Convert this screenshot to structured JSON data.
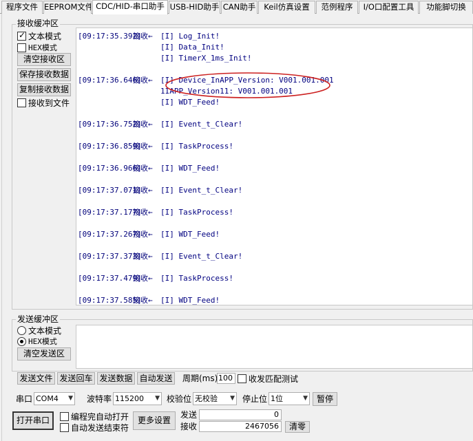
{
  "tabs": [
    {
      "label": "程序文件",
      "active": false
    },
    {
      "label": "EEPROM文件",
      "active": false
    },
    {
      "label": "CDC/HID-串口助手",
      "active": true
    },
    {
      "label": "USB-HID助手",
      "active": false
    },
    {
      "label": "CAN助手",
      "active": false
    },
    {
      "label": "Keil仿真设置",
      "active": false
    },
    {
      "label": "范例程序",
      "active": false
    },
    {
      "label": "I/O口配置工具",
      "active": false
    },
    {
      "label": "功能脚切换",
      "active": false
    }
  ],
  "receive": {
    "title": "接收缓冲区",
    "text_mode_label": "文本模式",
    "text_mode_checked": true,
    "hex_mode_label": "HEX模式",
    "hex_mode_checked": false,
    "clear_label": "清空接收区",
    "save_label": "保存接收数据",
    "copy_label": "复制接收数据",
    "to_file_label": "接收到文件",
    "to_file_checked": false,
    "log": [
      {
        "ts": "[09:17:35.392]",
        "tag": "接收←",
        "msg": "[I] Log_Init!"
      },
      {
        "ts": "",
        "tag": "",
        "msg": "[I] Data_Init!"
      },
      {
        "ts": "",
        "tag": "",
        "msg": "[I] TimerX_1ms_Init!"
      },
      {
        "ts": "",
        "tag": "",
        "msg": ""
      },
      {
        "ts": "[09:17:36.646]",
        "tag": "接收←",
        "msg": "[I] Device_InAPP_Version: V001.001.001"
      },
      {
        "ts": "",
        "tag": "",
        "msg": "1IAPP_Version11: V001.001.001"
      },
      {
        "ts": "",
        "tag": "",
        "msg": "[I] WDT_Feed!"
      },
      {
        "ts": "",
        "tag": "",
        "msg": ""
      },
      {
        "ts": "[09:17:36.752]",
        "tag": "接收←",
        "msg": "[I] Event_t_Clear!"
      },
      {
        "ts": "",
        "tag": "",
        "msg": ""
      },
      {
        "ts": "[09:17:36.859]",
        "tag": "接收←",
        "msg": "[I] TaskProcess!"
      },
      {
        "ts": "",
        "tag": "",
        "msg": ""
      },
      {
        "ts": "[09:17:36.966]",
        "tag": "接收←",
        "msg": "[I] WDT_Feed!"
      },
      {
        "ts": "",
        "tag": "",
        "msg": ""
      },
      {
        "ts": "[09:17:37.071]",
        "tag": "接收←",
        "msg": "[I] Event_t_Clear!"
      },
      {
        "ts": "",
        "tag": "",
        "msg": ""
      },
      {
        "ts": "[09:17:37.177]",
        "tag": "接收←",
        "msg": "[I] TaskProcess!"
      },
      {
        "ts": "",
        "tag": "",
        "msg": ""
      },
      {
        "ts": "[09:17:37.267]",
        "tag": "接收←",
        "msg": "[I] WDT_Feed!"
      },
      {
        "ts": "",
        "tag": "",
        "msg": ""
      },
      {
        "ts": "[09:17:37.373]",
        "tag": "接收←",
        "msg": "[I] Event_t_Clear!"
      },
      {
        "ts": "",
        "tag": "",
        "msg": ""
      },
      {
        "ts": "[09:17:37.479]",
        "tag": "接收←",
        "msg": "[I] TaskProcess!"
      },
      {
        "ts": "",
        "tag": "",
        "msg": ""
      },
      {
        "ts": "[09:17:37.585]",
        "tag": "接收←",
        "msg": "[I] WDT_Feed!"
      }
    ]
  },
  "send": {
    "title": "发送缓冲区",
    "text_mode_label": "文本模式",
    "text_mode_selected": false,
    "hex_mode_label": "HEX模式",
    "hex_mode_selected": true,
    "clear_label": "清空发送区",
    "value": ""
  },
  "send_bar": {
    "send_file": "发送文件",
    "send_enter": "发送回车",
    "send_data": "发送数据",
    "auto_send": "自动发送",
    "period_label": "周期(ms)",
    "period_value": "100",
    "match_test_label": "收发匹配测试",
    "match_test_checked": false
  },
  "port": {
    "port_label": "串口",
    "port_value": "COM4",
    "baud_label": "波特率",
    "baud_value": "115200",
    "parity_label": "校验位",
    "parity_value": "无校验",
    "stop_label": "停止位",
    "stop_value": "1位",
    "pause_label": "暂停",
    "open_label": "打开串口",
    "auto_open_label": "编程完自动打开",
    "auto_open_checked": false,
    "auto_send_end_label": "自动发送结束符",
    "auto_send_end_checked": false,
    "more_settings_label": "更多设置",
    "sent_label": "发送",
    "sent_count": "0",
    "recv_label": "接收",
    "recv_count": "2467056",
    "clear_count_label": "清零"
  },
  "colors": {
    "log_text": "#000080",
    "annotation_ellipse": "#cc2020"
  }
}
